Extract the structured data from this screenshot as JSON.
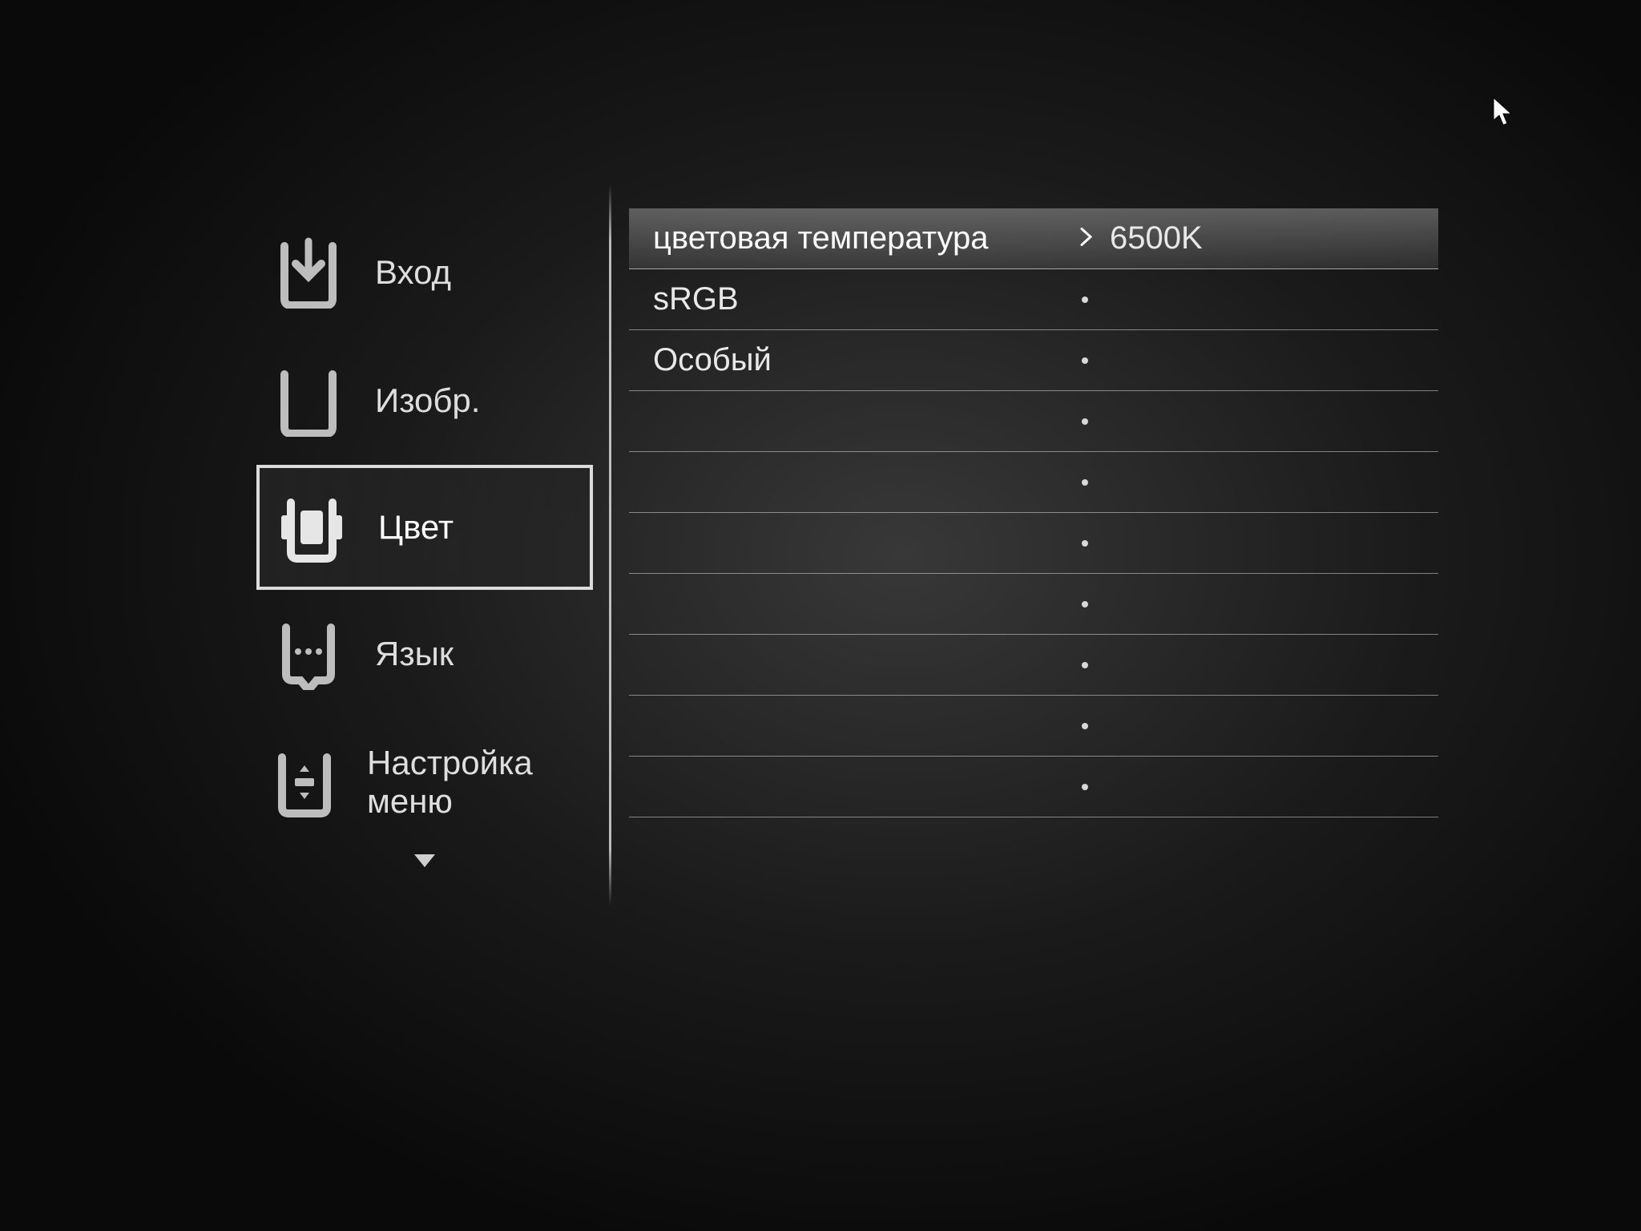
{
  "sidebar": {
    "items": [
      {
        "id": "input",
        "label": "Вход",
        "icon": "input-icon"
      },
      {
        "id": "image",
        "label": "Изобр.",
        "icon": "image-icon"
      },
      {
        "id": "color",
        "label": "Цвет",
        "icon": "color-icon"
      },
      {
        "id": "language",
        "label": "Язык",
        "icon": "language-icon"
      },
      {
        "id": "menu",
        "label": "Настройка меню",
        "icon": "menu-setup-icon"
      }
    ],
    "selected": "color",
    "scroll_indicator": "down"
  },
  "panel": {
    "rows": [
      {
        "label": "цветовая температура",
        "value": "6500K",
        "active": true,
        "indicator": "chevron"
      },
      {
        "label": "sRGB",
        "value": "",
        "active": false,
        "indicator": "dot"
      },
      {
        "label": "Особый",
        "value": "",
        "active": false,
        "indicator": "dot"
      },
      {
        "label": "",
        "value": "",
        "active": false,
        "indicator": "dot"
      },
      {
        "label": "",
        "value": "",
        "active": false,
        "indicator": "dot"
      },
      {
        "label": "",
        "value": "",
        "active": false,
        "indicator": "dot"
      },
      {
        "label": "",
        "value": "",
        "active": false,
        "indicator": "dot"
      },
      {
        "label": "",
        "value": "",
        "active": false,
        "indicator": "dot"
      },
      {
        "label": "",
        "value": "",
        "active": false,
        "indicator": "dot"
      },
      {
        "label": "",
        "value": "",
        "active": false,
        "indicator": "dot"
      }
    ]
  },
  "colors": {
    "highlight_bg": "rgba(255,255,255,0.30)",
    "text": "#e8e8e8"
  }
}
